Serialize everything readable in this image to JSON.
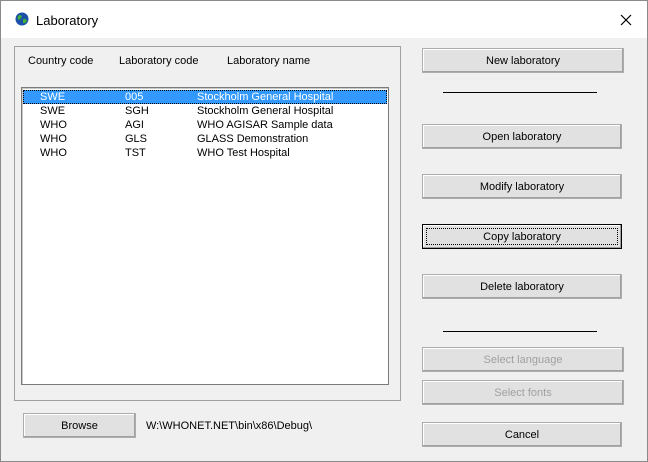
{
  "window": {
    "title": "Laboratory"
  },
  "columns": {
    "country": "Country code",
    "code": "Laboratory code",
    "name": "Laboratory name"
  },
  "rows": [
    {
      "country": "SWE",
      "code": "005",
      "name": "Stockholm General Hospital",
      "selected": true
    },
    {
      "country": "SWE",
      "code": "SGH",
      "name": "Stockholm General Hospital",
      "selected": false
    },
    {
      "country": "WHO",
      "code": "AGI",
      "name": "WHO AGISAR Sample data",
      "selected": false
    },
    {
      "country": "WHO",
      "code": "GLS",
      "name": "GLASS Demonstration",
      "selected": false
    },
    {
      "country": "WHO",
      "code": "TST",
      "name": "WHO Test Hospital",
      "selected": false
    }
  ],
  "buttons": {
    "new": "New laboratory",
    "open": "Open laboratory",
    "modify": "Modify laboratory",
    "copy": "Copy laboratory",
    "delete": "Delete laboratory",
    "select_language": "Select language",
    "select_fonts": "Select fonts",
    "cancel": "Cancel",
    "browse": "Browse"
  },
  "path": "W:\\WHONET.NET\\bin\\x86\\Debug\\",
  "colors": {
    "selection": "#3399ff",
    "disabled_text": "#a0a0a0"
  }
}
